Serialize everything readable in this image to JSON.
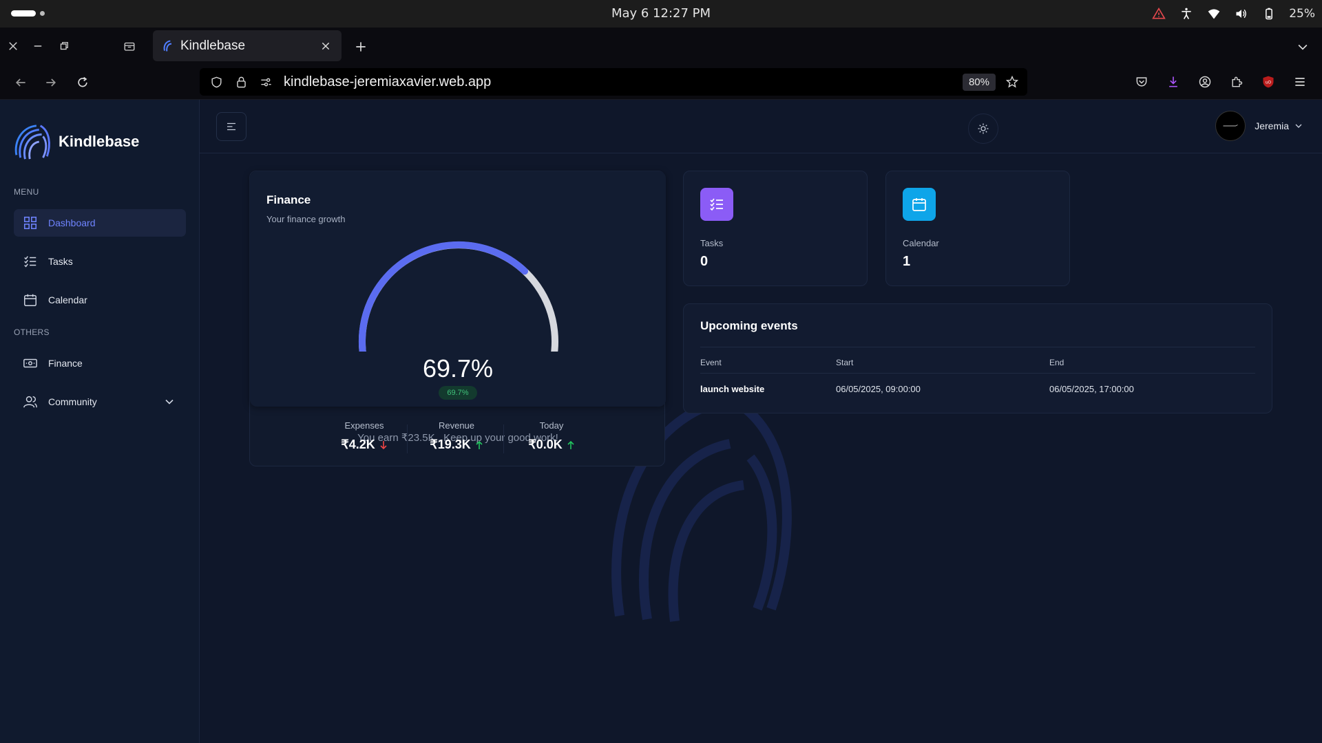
{
  "os": {
    "clock": "May 6  12:27 PM",
    "battery": "25%"
  },
  "browser": {
    "tab_title": "Kindlebase",
    "url": "kindlebase-jeremiaxavier.web.app",
    "zoom": "80%"
  },
  "sidebar": {
    "brand": "Kindlebase",
    "menu_label": "MENU",
    "others_label": "OTHERS",
    "items": [
      {
        "label": "Dashboard",
        "icon": "grid-icon"
      },
      {
        "label": "Tasks",
        "icon": "checklist-icon"
      },
      {
        "label": "Calendar",
        "icon": "calendar-icon"
      },
      {
        "label": "Finance",
        "icon": "money-icon"
      },
      {
        "label": "Community",
        "icon": "users-icon"
      }
    ]
  },
  "header": {
    "user_name": "Jeremia"
  },
  "finance": {
    "title": "Finance",
    "subtitle": "Your finance growth",
    "percent": "69.7%",
    "percent_badge": "69.7%",
    "gauge_fraction": 0.697,
    "message": "You earn ₹23.5K . Keep up your good work!",
    "stats": [
      {
        "label": "Expenses",
        "value": "₹4.2K",
        "trend": "down"
      },
      {
        "label": "Revenue",
        "value": "₹19.3K",
        "trend": "up"
      },
      {
        "label": "Today",
        "value": "₹0.0K",
        "trend": "up"
      }
    ]
  },
  "cards": {
    "tasks": {
      "label": "Tasks",
      "value": "0",
      "color": "#8b5cf6"
    },
    "calendar": {
      "label": "Calendar",
      "value": "1",
      "color": "#0ea5e9"
    }
  },
  "events": {
    "title": "Upcoming events",
    "columns": [
      "Event",
      "Start",
      "End"
    ],
    "rows": [
      {
        "event": "launch website",
        "start": "06/05/2025, 09:00:00",
        "end": "06/05/2025, 17:00:00"
      }
    ]
  },
  "colors": {
    "accent": "#6f84ff",
    "gauge_fill": "#5b6cf0",
    "gauge_track": "#d6d8de",
    "down": "#ef4444",
    "up": "#22c55e"
  }
}
